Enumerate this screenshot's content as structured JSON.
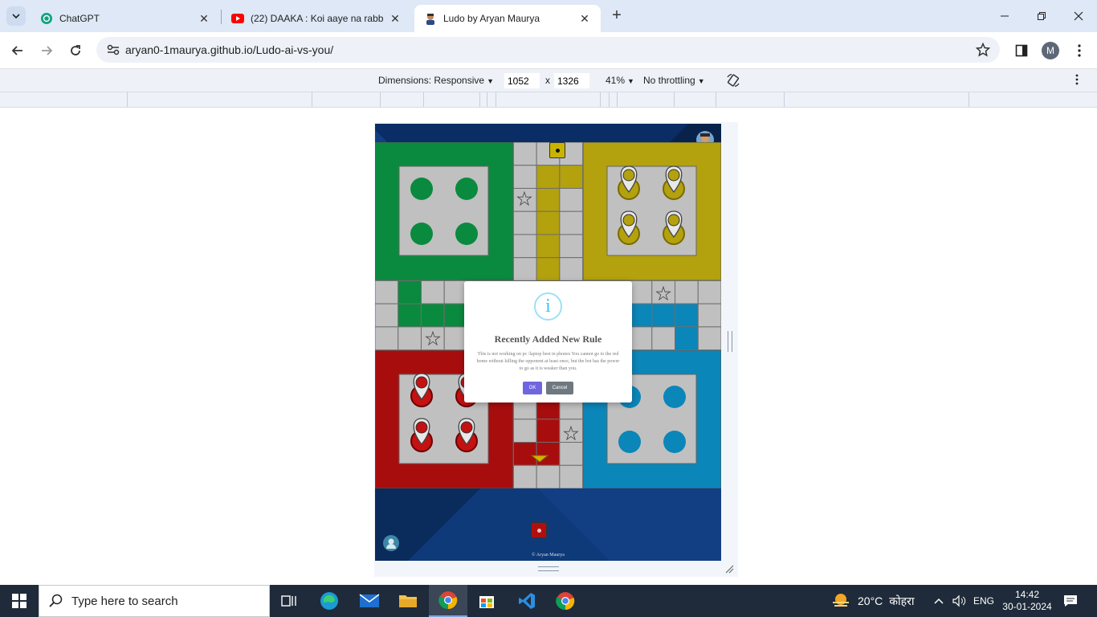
{
  "browser": {
    "tabs": [
      {
        "title": "ChatGPT",
        "icon": "chatgpt-icon"
      },
      {
        "title": "(22) DAAKA : Koi aaye na rabba",
        "icon": "youtube-icon"
      },
      {
        "title": "Ludo by Aryan Maurya",
        "icon": "ludo-favicon"
      }
    ],
    "url": "aryan0-1maurya.github.io/Ludo-ai-vs-you/",
    "profile_initial": "M"
  },
  "devtools": {
    "dimensions_label": "Dimensions: Responsive",
    "width": "1052",
    "times": "x",
    "height": "1326",
    "zoom": "41%",
    "throttling": "No throttling"
  },
  "game": {
    "colors": {
      "green": "#0a8a3f",
      "yellow": "#b3a10e",
      "red": "#a80d0d",
      "blue": "#0b86b8"
    },
    "dialog": {
      "icon_glyph": "i",
      "title": "Recently Added New Rule",
      "text": "This is not working on pc /laptop best in phones You cannot go to the red home without killing the opponent at least once, but the bot has the power to go as it is weaker than you.",
      "ok_label": "OK",
      "cancel_label": "Cancel"
    },
    "credit": "© Aryan Maurya"
  },
  "taskbar": {
    "search_placeholder": "Type here to search",
    "weather_temp": "20°C",
    "weather_desc": "कोहरा",
    "language": "ENG",
    "time": "14:42",
    "date": "30-01-2024"
  }
}
